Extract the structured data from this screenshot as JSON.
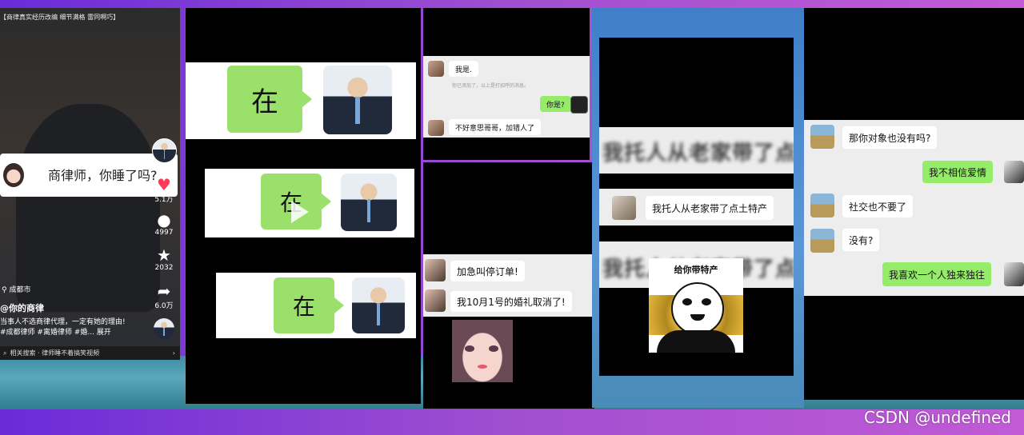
{
  "douyin": {
    "top_caption": "【商律真实经历改编 细节满格 雷同啊巧】",
    "message_text": "商律师，你睡了吗?",
    "like_count": "5.1万",
    "comment_count": "4997",
    "fav_count": "2032",
    "share_count": "6.0万",
    "location": "成都市",
    "author": "@你的商律",
    "desc_line1": "当事人不选商律代理，一定有她的理由!",
    "desc_line2": "#成都律师 #离婚律师 #婚...  展开",
    "search_bar": "相关搜索 · 律师睡不着搞笑视频"
  },
  "zai": {
    "bubble1": "在",
    "bubble2": "在",
    "bubble3": "在"
  },
  "chat_mid": {
    "msg_wo_shi": "我是.",
    "system_note": "你已添加了，以上是打招呼的消息。",
    "msg_ni_shi": "你是?",
    "msg_sorry": "不好意思哥哥，加错人了",
    "msg_stop_order": "加急叫停订单!",
    "msg_cancel_wedding": "我10月1号的婚礼取消了!"
  },
  "chat_right1": {
    "blur_text": "我托人从老家带了点",
    "msg_specialty": "我托人从老家带了点土特产",
    "sticker_caption": "给你带特产"
  },
  "chat_right2": {
    "msg1": "那你对象也没有吗?",
    "msg2": "我不相信爱情",
    "msg3": "社交也不要了",
    "msg4": "没有?",
    "msg5": "我喜欢一个人独来独往"
  },
  "watermark": "CSDN @undefined"
}
